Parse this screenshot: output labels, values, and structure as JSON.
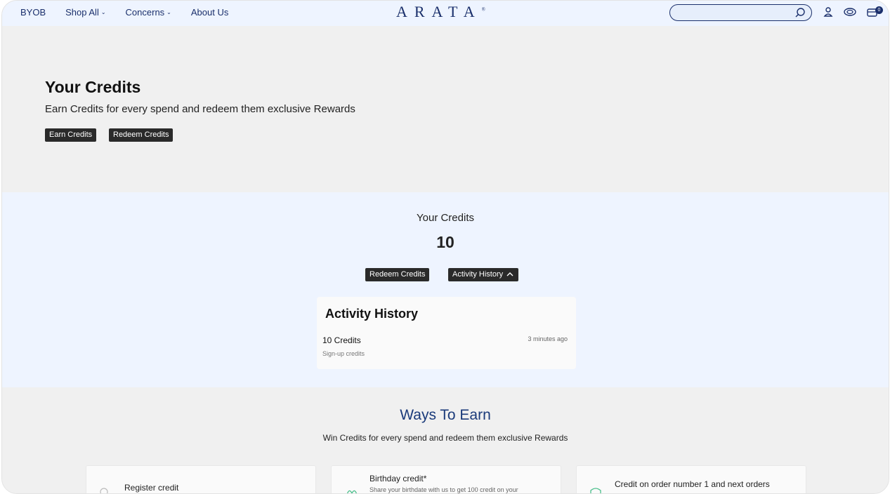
{
  "header": {
    "nav": [
      {
        "label": "BYOB",
        "dropdown": false
      },
      {
        "label": "Shop All",
        "dropdown": true
      },
      {
        "label": "Concerns",
        "dropdown": true
      },
      {
        "label": "About Us",
        "dropdown": false
      }
    ],
    "logo": "ARATA",
    "logo_mark": "®",
    "search_placeholder": "",
    "cart_count": "0",
    "icons": [
      "search-icon",
      "user-icon",
      "support-icon",
      "cart-icon"
    ]
  },
  "hero": {
    "title": "Your Credits",
    "subtitle": "Earn Credits for every spend and redeem them exclusive Rewards",
    "buttons": {
      "earn": "Earn Credits",
      "redeem": "Redeem Credits"
    }
  },
  "credits": {
    "label": "Your Credits",
    "amount": "10",
    "buttons": {
      "redeem": "Redeem Credits",
      "history": "Activity History"
    },
    "activity": {
      "title": "Activity History",
      "entries": [
        {
          "amount": "10 Credits",
          "time": "3 minutes ago",
          "description": "Sign-up credits"
        }
      ]
    }
  },
  "earn": {
    "title": "Ways To Earn",
    "subtitle": "Win Credits for every spend and redeem them exclusive Rewards",
    "cards": [
      {
        "title": "Register credit",
        "subtitle": ""
      },
      {
        "title": "Birthday credit*",
        "subtitle": "Share your birthdate with us to get 100 credit on your"
      },
      {
        "title": "Credit on order number 1 and next orders",
        "subtitle": ""
      }
    ]
  },
  "colors": {
    "navy": "#1a2f6b",
    "header_bg": "#eef4ff",
    "button_dark": "#2a2a2a"
  }
}
